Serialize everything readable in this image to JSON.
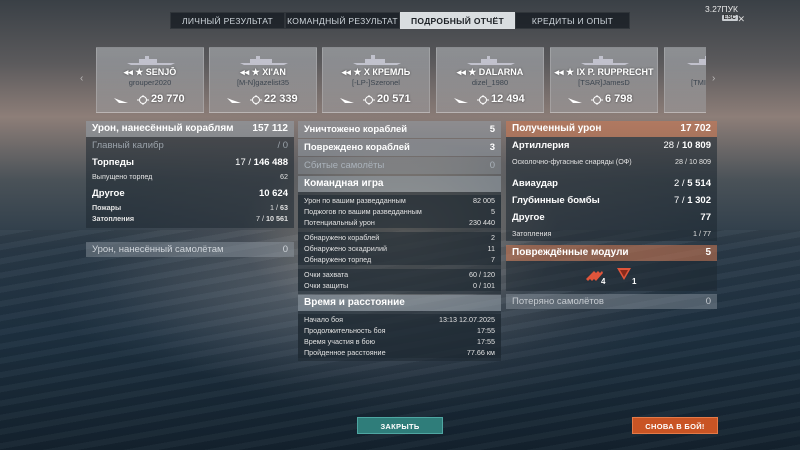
{
  "tabs": [
    "ЛИЧНЫЙ РЕЗУЛЬТАТ",
    "КОМАНДНЫЙ РЕЗУЛЬТАТ",
    "ПОДРОБНЫЙ ОТЧЁТ",
    "КРЕДИТЫ И ОПЫТ"
  ],
  "active_tab": 2,
  "topbar": {
    "version": "3.27ПУК",
    "esc_label": "ESC"
  },
  "ships": [
    {
      "name": "SENJŌ",
      "prefix": "",
      "player": "grouper2020",
      "damage": "29 770"
    },
    {
      "name": "XI'AN",
      "prefix": "",
      "player": "[M-N]gazelist35",
      "damage": "22 339"
    },
    {
      "name": "КРЕМЛЬ",
      "prefix": "X",
      "player": "[-LP-]Szeronel",
      "damage": "20 571"
    },
    {
      "name": "DALARNA",
      "prefix": "",
      "player": "dizel_1980",
      "damage": "12 494"
    },
    {
      "name": "P. RUPPRECHT",
      "prefix": "IX",
      "player": "[TSAR]JamesD",
      "damage": "6 798"
    },
    {
      "name": "",
      "prefix": "",
      "player": "[TMI",
      "damage": ""
    }
  ],
  "damage_panel": {
    "header": {
      "label": "Урон, нанесённый кораблям",
      "value": "157 112"
    },
    "main_battery": {
      "label": "Главный калибр",
      "value": "/ 0"
    },
    "torpedoes": {
      "label": "Торпеды",
      "value_a": "17",
      "value_b": "146 488"
    },
    "torpedoes_fired": {
      "label": "Выпущено торпед",
      "value": "62"
    },
    "other": {
      "label": "Другое",
      "value": "10 624"
    },
    "fires": {
      "label": "Пожары",
      "value_a": "1",
      "value_b": "63"
    },
    "floods": {
      "label": "Затопления",
      "value_a": "7",
      "value_b": "10 561"
    },
    "aircraft_damage": {
      "label": "Урон, нанесённый самолётам",
      "value": "0"
    }
  },
  "team_panel": {
    "destroyed": {
      "label": "Уничтожено кораблей",
      "value": "5"
    },
    "damaged": {
      "label": "Повреждено кораблей",
      "value": "3"
    },
    "planes_shot": {
      "label": "Сбитые самолёты",
      "value": "0"
    },
    "team_play_header": "Командная игра",
    "spotting_damage": {
      "label": "Урон по вашим разведданным",
      "value": "82 005"
    },
    "spotting_fires": {
      "label": "Поджогов по вашим разведданным",
      "value": "5"
    },
    "potential_damage": {
      "label": "Потенциальный урон",
      "value": "230 440"
    },
    "ships_spotted": {
      "label": "Обнаружено кораблей",
      "value": "2"
    },
    "squadrons_spotted": {
      "label": "Обнаружено эскадрилий",
      "value": "11"
    },
    "torpedoes_spotted": {
      "label": "Обнаружено торпед",
      "value": "7"
    },
    "capture_points": {
      "label": "Очки захвата",
      "value": "60 / 120"
    },
    "defense_points": {
      "label": "Очки защиты",
      "value": "0 / 101"
    },
    "time_header": "Время и расстояние",
    "battle_start": {
      "label": "Начало боя",
      "value": "13:13  12.07.2025"
    },
    "battle_duration": {
      "label": "Продолжительность боя",
      "value": "17:55"
    },
    "participation": {
      "label": "Время участия в бою",
      "value": "17:55"
    },
    "distance": {
      "label": "Пройденное расстояние",
      "value": "77.66 км"
    }
  },
  "received_panel": {
    "header": {
      "label": "Полученный урон",
      "value": "17 702"
    },
    "artillery": {
      "label": "Артиллерия",
      "value_a": "28",
      "value_b": "10 809"
    },
    "he_shells": {
      "label": "Осколочно-фугасные снаряды (ОФ)",
      "value": "28 / 10 809"
    },
    "aviation": {
      "label": "Авиаудар",
      "value_a": "2",
      "value_b": "5 514"
    },
    "depth_charges": {
      "label": "Глубинные бомбы",
      "value_a": "7",
      "value_b": "1 302"
    },
    "other": {
      "label": "Другое",
      "value": "77"
    },
    "floods": {
      "label": "Затопления",
      "value": "1 / 77"
    },
    "modules_header": {
      "label": "Повреждённые модули",
      "value": "5"
    },
    "modules": [
      {
        "icon": "torpedo-tubes-icon",
        "count": "4"
      },
      {
        "icon": "steering-gear-icon",
        "count": "1"
      }
    ],
    "planes_lost": {
      "label": "Потеряно самолётов",
      "value": "0"
    }
  },
  "buttons": {
    "close": "ЗАКРЫТЬ",
    "battle_again": "СНОВА В БОЙ!"
  },
  "colors": {
    "accent_orange": "#c95424",
    "accent_teal": "#2f7d7a"
  }
}
